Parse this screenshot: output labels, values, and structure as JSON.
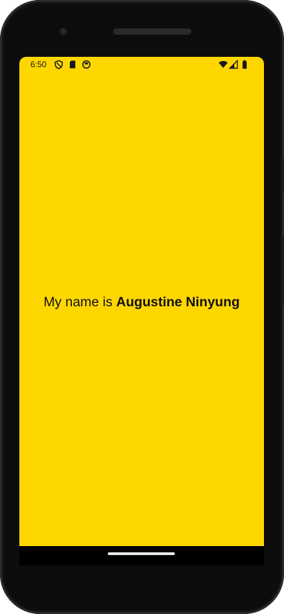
{
  "status_bar": {
    "time": "6:50",
    "left_icons": [
      "vpn-shield-icon",
      "sd-card-icon",
      "app-notification-icon"
    ],
    "right_icons": [
      "wifi-icon",
      "cell-signal-icon",
      "battery-icon"
    ]
  },
  "main": {
    "prefix": "My name is ",
    "name": "Augustine Ninyung"
  },
  "colors": {
    "background": "#FFD700",
    "text": "#111111"
  }
}
